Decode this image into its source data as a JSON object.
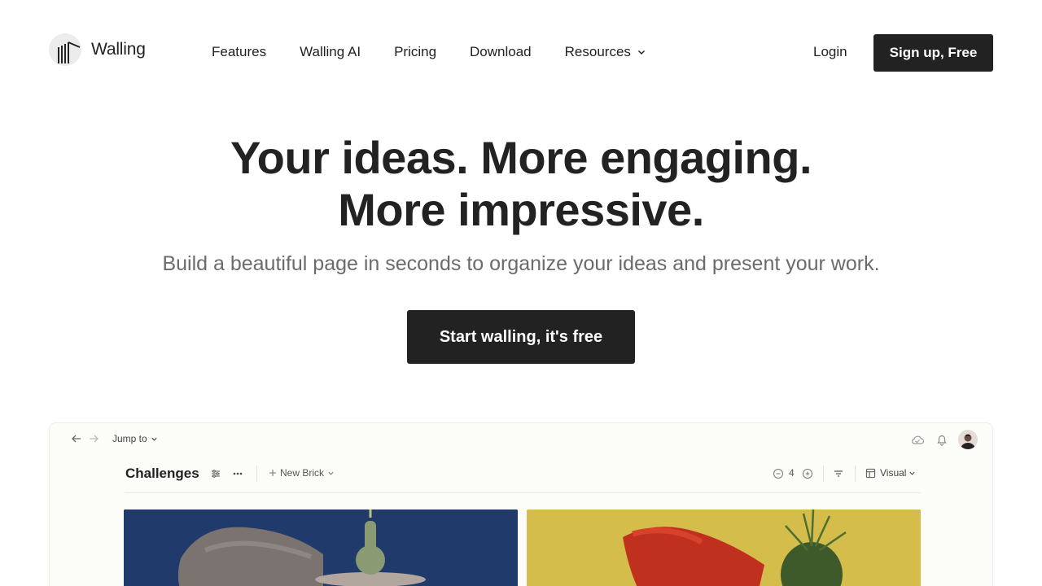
{
  "brand": {
    "name": "Walling"
  },
  "nav": {
    "items": [
      {
        "label": "Features"
      },
      {
        "label": "Walling AI"
      },
      {
        "label": "Pricing"
      },
      {
        "label": "Download"
      },
      {
        "label": "Resources",
        "has_dropdown": true
      }
    ],
    "login_label": "Login",
    "signup_label": "Sign up, Free"
  },
  "hero": {
    "title_line1": "Your ideas. More engaging.",
    "title_line2": "More impressive.",
    "subtitle": "Build a beautiful page in seconds to organize your ideas and present your work.",
    "cta_label": "Start walling, it's free"
  },
  "preview": {
    "jump_label": "Jump to",
    "board_title": "Challenges",
    "new_brick_label": "New Brick",
    "zoom_value": "4",
    "view_label": "Visual",
    "icons": [
      "arrow-left-icon",
      "arrow-right-icon",
      "cloud-icon",
      "bell-icon",
      "sliders-icon",
      "more-icon",
      "plus-icon",
      "minus-circle-icon",
      "plus-circle-icon",
      "filter-icon",
      "layout-icon"
    ]
  },
  "colors": {
    "primary_button": "#222222",
    "subtitle_text": "#6b6b6b",
    "card_blue": "#1f3a6b",
    "card_yellow": "#d4bd4a"
  }
}
